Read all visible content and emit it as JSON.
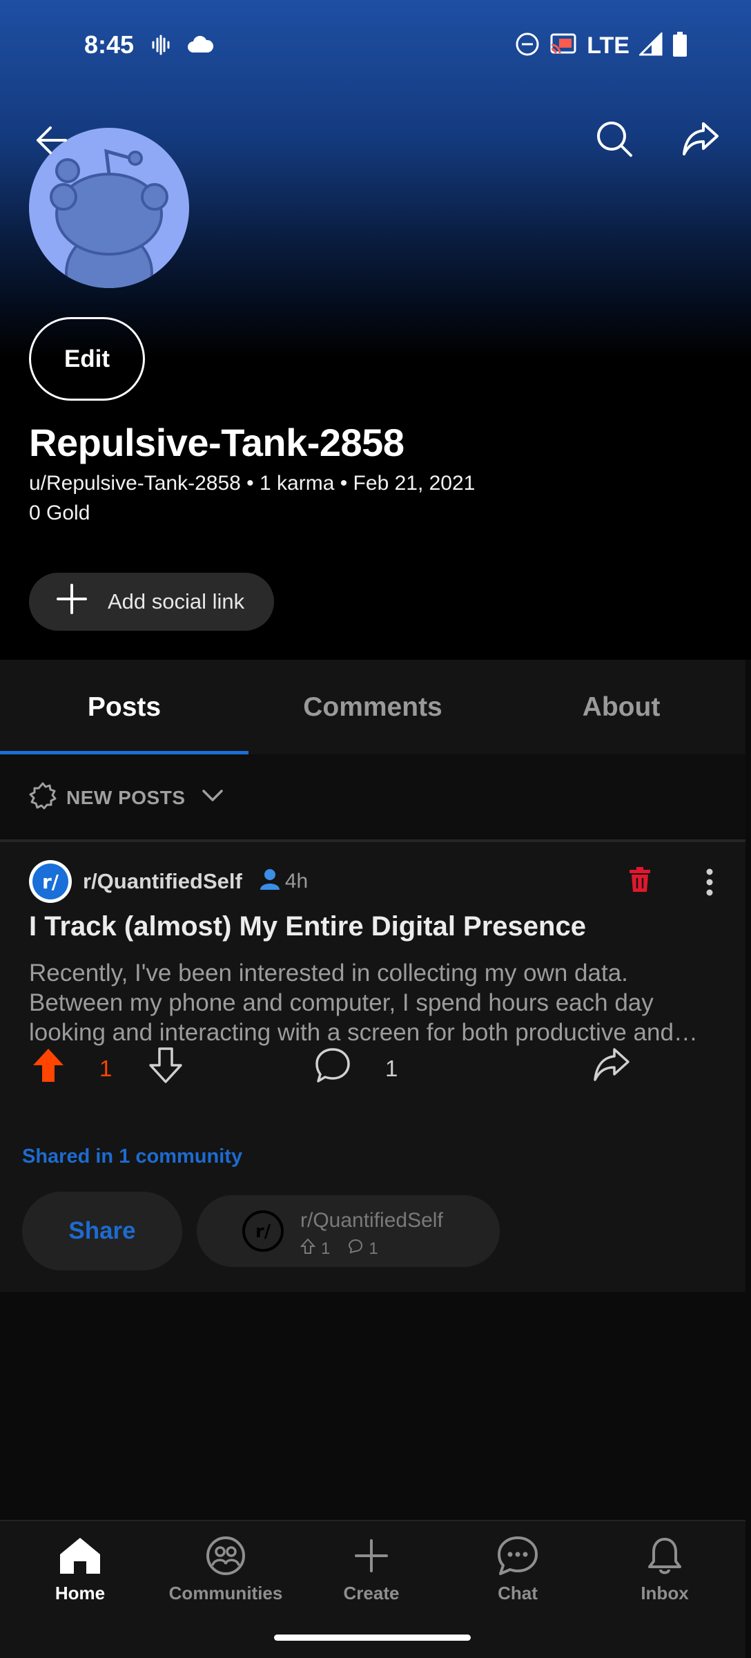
{
  "status_bar": {
    "time": "8:45",
    "network": "LTE",
    "icons_left": [
      "voicemail-wave-icon",
      "cloud-icon"
    ],
    "icons_right": [
      "do-not-disturb-icon",
      "cast-icon",
      "signal-icon",
      "battery-icon"
    ]
  },
  "header": {
    "back_icon": "back-arrow-icon",
    "search_icon": "search-icon",
    "share_icon": "share-icon"
  },
  "profile": {
    "edit_label": "Edit",
    "display_name": "Repulsive-Tank-2858",
    "meta_line": "u/Repulsive-Tank-2858 • 1 karma • Feb 21, 2021",
    "gold_line": "0 Gold",
    "add_social_label": "Add social link"
  },
  "tabs": [
    {
      "label": "Posts",
      "active": true
    },
    {
      "label": "Comments",
      "active": false
    },
    {
      "label": "About",
      "active": false
    }
  ],
  "sort": {
    "label": "NEW POSTS"
  },
  "post": {
    "subreddit": "r/QuantifiedSelf",
    "age": "4h",
    "title": "I Track (almost) My Entire Digital Presence",
    "body": "Recently, I've been interested in collecting my own data. Between my phone and computer, I spend hours each day looking and interacting with a screen for both productive and unproductive purposes...",
    "upvotes": "1",
    "comments": "1",
    "colors": {
      "upvote": "#ff4500",
      "delete": "#e0182d",
      "link": "#1d6bd0"
    }
  },
  "crosspost": {
    "shared_label": "Shared in 1 community",
    "share_button": "Share",
    "community_name": "r/QuantifiedSelf",
    "community_upvotes": "1",
    "community_comments": "1"
  },
  "bottom_nav": [
    {
      "label": "Home",
      "icon": "home-icon",
      "active": true
    },
    {
      "label": "Communities",
      "icon": "communities-icon",
      "active": false
    },
    {
      "label": "Create",
      "icon": "plus-icon",
      "active": false
    },
    {
      "label": "Chat",
      "icon": "chat-icon",
      "active": false
    },
    {
      "label": "Inbox",
      "icon": "bell-icon",
      "active": false
    }
  ]
}
